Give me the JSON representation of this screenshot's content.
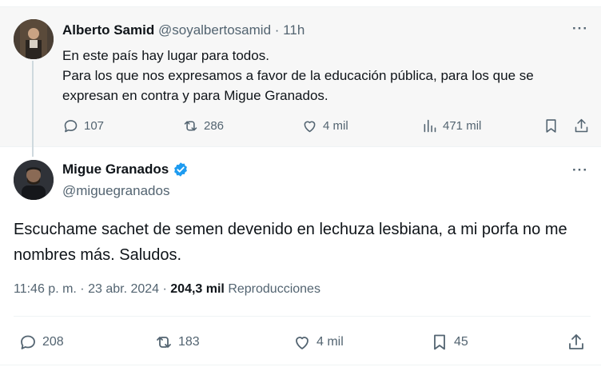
{
  "quoted_tweet": {
    "author_name": "Alberto Samid",
    "handle": "@soyalbertosamid",
    "separator": "·",
    "time": "11h",
    "more": "···",
    "lines": [
      "En este país hay lugar para todos.",
      "Para los que nos expresamos a favor de la educación pública, para los que se expresan en contra y para Migue Granados."
    ],
    "actions": {
      "replies": "107",
      "reposts": "286",
      "likes": "4 mil",
      "views": "471 mil"
    }
  },
  "main_tweet": {
    "author_name": "Migue Granados",
    "handle": "@miguegranados",
    "more": "···",
    "text": "Escuchame sachet de semen devenido en lechuza lesbiana, a mi porfa no me nombres más. Saludos.",
    "timestamp": "11:46 p. m. · 23 abr. 2024 · ",
    "views_count": "204,3 mil",
    "views_label": " Reproducciones",
    "actions": {
      "replies": "208",
      "reposts": "183",
      "likes": "4 mil",
      "bookmarks": "45"
    }
  },
  "colors": {
    "text": "#0f1419",
    "secondary": "#536471",
    "verified": "#1d9bf0",
    "quoted_bg": "#f7f7f7"
  }
}
